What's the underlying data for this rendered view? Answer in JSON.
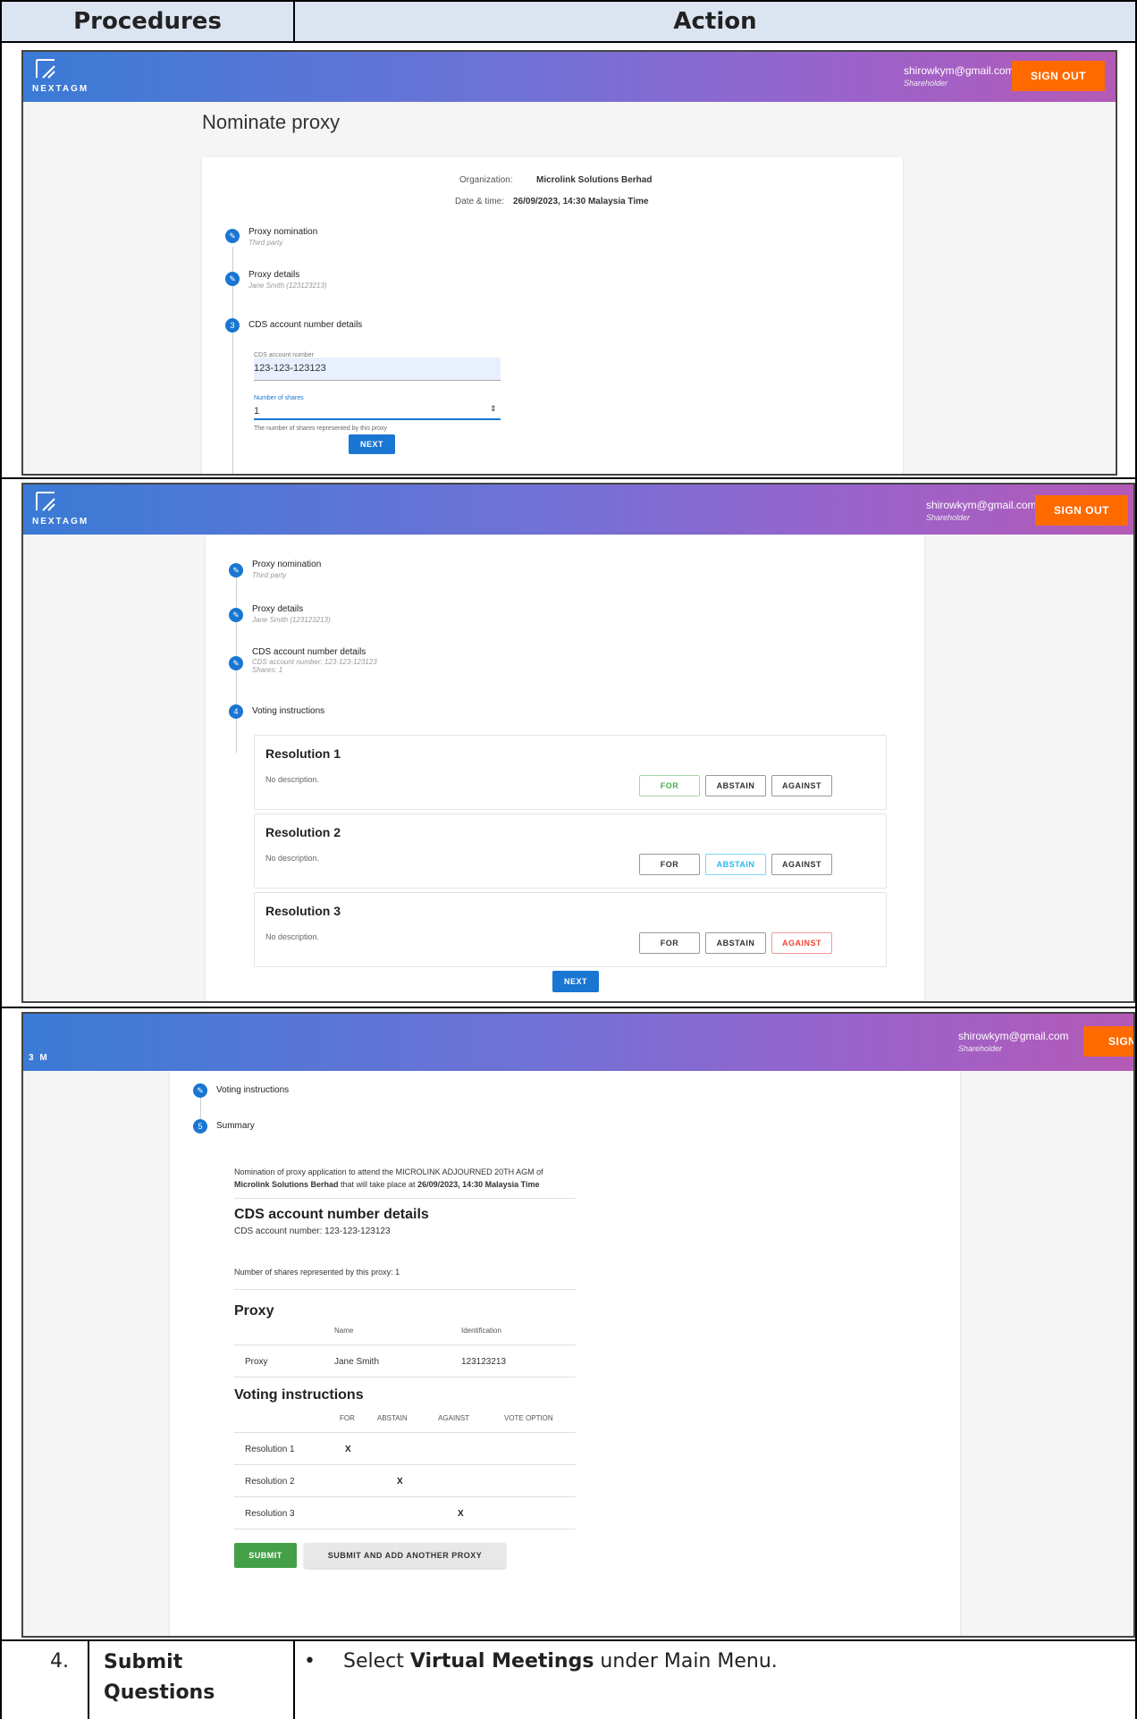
{
  "table": {
    "headers": {
      "procedures": "Procedures",
      "action": "Action"
    },
    "footer_row": {
      "number": "4.",
      "procedure": "Submit Questions",
      "bullet": "•",
      "action_prefix": "Select ",
      "action_bold": "Virtual Meetings",
      "action_suffix": " under Main Menu."
    }
  },
  "app": {
    "logo_text": "NEXTAGM",
    "logo_text_partial": "3 M",
    "user_email": "shirowkym@gmail.com",
    "user_role": "Shareholder",
    "signout_label": "SIGN OUT",
    "signout_partial": "SIGN",
    "brand_gradient": [
      "#3a7bd5",
      "#6f72d6",
      "#9a63cc",
      "#b45ab6"
    ],
    "accent": "#ff6a00",
    "primary": "#1976d2"
  },
  "panel1": {
    "page_title": "Nominate proxy",
    "org_label": "Organization:",
    "org_value": "Microlink Solutions Berhad",
    "date_label": "Date & time:",
    "date_value": "26/09/2023, 14:30 Malaysia Time",
    "steps": [
      {
        "title": "Proxy nomination",
        "sub": "Third party"
      },
      {
        "title": "Proxy details",
        "sub": "Jane Smith (123123213)"
      },
      {
        "number": "3",
        "title": "CDS account number details"
      }
    ],
    "cds_label": "CDS account number",
    "cds_value": "123-123-123123",
    "shares_label": "Number of shares",
    "shares_value": "1",
    "shares_help": "The number of shares represented by this proxy",
    "next_label": "NEXT"
  },
  "panel2": {
    "steps": [
      {
        "title": "Proxy nomination",
        "sub": "Third party"
      },
      {
        "title": "Proxy details",
        "sub": "Jane Smith (123123213)"
      },
      {
        "title": "CDS account number details",
        "sub": "CDS account number: 123-123-123123",
        "sub2": "Shares: 1"
      },
      {
        "number": "4",
        "title": "Voting instructions"
      }
    ],
    "resolutions": [
      {
        "title": "Resolution 1",
        "desc": "No description.",
        "selected": "FOR"
      },
      {
        "title": "Resolution 2",
        "desc": "No description.",
        "selected": "ABSTAIN"
      },
      {
        "title": "Resolution 3",
        "desc": "No description.",
        "selected": "AGAINST"
      }
    ],
    "vote_labels": {
      "for": "FOR",
      "abstain": "ABSTAIN",
      "against": "AGAINST"
    },
    "next_label": "NEXT"
  },
  "panel3": {
    "step_voting": "Voting instructions",
    "step_summary_number": "5",
    "step_summary": "Summary",
    "intro_line1": "Nomination of proxy application to attend the MICROLINK ADJOURNED 20TH AGM of",
    "intro_org": "Microlink Solutions Berhad",
    "intro_mid": " that will take place at ",
    "intro_date": "26/09/2023, 14:30 Malaysia Time",
    "cds_heading": "CDS account number details",
    "cds_line": "CDS account number: 123-123-123123",
    "shares_line": "Number of shares represented by this proxy: 1",
    "proxy_heading": "Proxy",
    "proxy_cols": {
      "name": "Name",
      "id": "Identification"
    },
    "proxy_row": {
      "label": "Proxy",
      "name": "Jane Smith",
      "id": "123123213"
    },
    "voting_heading": "Voting instructions",
    "voting_cols": [
      "FOR",
      "ABSTAIN",
      "AGAINST",
      "VOTE OPTION"
    ],
    "voting_rows": [
      {
        "label": "Resolution 1",
        "mark": "X"
      },
      {
        "label": "Resolution 2",
        "mark": "X"
      },
      {
        "label": "Resolution 3",
        "mark": "X"
      }
    ],
    "submit_label": "SUBMIT",
    "submit_another_label": "SUBMIT AND ADD ANOTHER PROXY"
  }
}
